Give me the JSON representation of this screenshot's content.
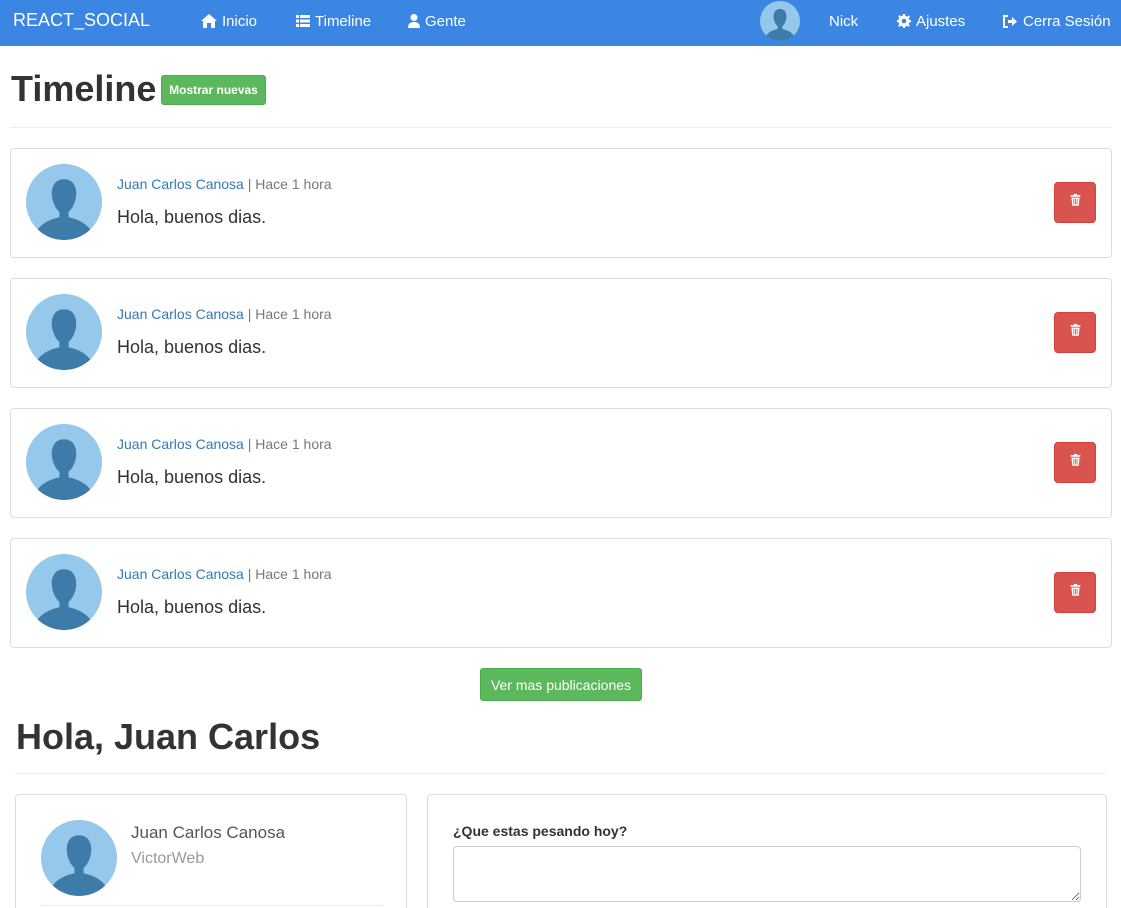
{
  "navbar": {
    "brand": "REACT_SOCIAL",
    "items": [
      {
        "label": "Inicio",
        "icon": "home-icon"
      },
      {
        "label": "Timeline",
        "icon": "list-icon"
      },
      {
        "label": "Gente",
        "icon": "user-icon"
      }
    ],
    "user_name": "Nick",
    "settings_label": "Ajustes",
    "logout_label": "Cerra Sesión"
  },
  "timeline": {
    "title": "Timeline",
    "show_new_label": "Mostrar nuevas",
    "posts": [
      {
        "author": "Juan Carlos Canosa",
        "separator": " | ",
        "time": "Hace 1 hora",
        "text": "Hola, buenos dias."
      },
      {
        "author": "Juan Carlos Canosa",
        "separator": " | ",
        "time": "Hace 1 hora",
        "text": "Hola, buenos dias."
      },
      {
        "author": "Juan Carlos Canosa",
        "separator": " | ",
        "time": "Hace 1 hora",
        "text": "Hola, buenos dias."
      },
      {
        "author": "Juan Carlos Canosa",
        "separator": " | ",
        "time": "Hace 1 hora",
        "text": "Hola, buenos dias."
      }
    ],
    "more_label": "Ver mas publicaciones"
  },
  "home": {
    "greeting": "Hola, Juan Carlos",
    "profile": {
      "name": "Juan Carlos Canosa",
      "username": "VictorWeb"
    },
    "compose": {
      "label": "¿Que estas pesando hoy?",
      "value": "",
      "placeholder": ""
    }
  },
  "colors": {
    "navbar": "#3b86e3",
    "success": "#5cb85c",
    "danger": "#d9534f",
    "link": "#337ab7"
  }
}
